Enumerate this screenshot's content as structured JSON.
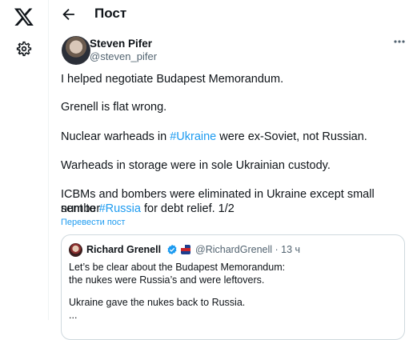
{
  "sidebar": {
    "logo_icon": "x-logo-icon",
    "settings_icon": "gear-icon"
  },
  "header": {
    "back_icon": "arrow-left-icon",
    "title": "Пост"
  },
  "tweet": {
    "author_name": "Steven Pifer",
    "author_handle": "@steven_pifer",
    "more_icon": "more-horizontal-icon",
    "lines": {
      "l1": "I helped negotiate Budapest Memorandum.",
      "l2": "Grenell is flat wrong.",
      "l3_pre": "Nuclear warheads in ",
      "l3_tag": "#Ukraine",
      "l3_post": " were ex-Soviet, not Russian.",
      "l4": "Warheads in storage were in sole Ukrainian custody.",
      "l5": "ICBMs and bombers were eliminated in Ukraine except small number",
      "l6_pre": "sent to ",
      "l6_tag": "#Russia",
      "l6_post": " for debt relief. 1/2"
    },
    "translate_label": "Перевести пост"
  },
  "quote": {
    "author_name": "Richard Grenell",
    "verified_icon": "verified-badge-icon",
    "flag_icon": "affiliate-flag-icon",
    "author_handle": "@RichardGrenell · 13 ч",
    "lines": {
      "q1": "Let’s be clear about the Budapest Memorandum:",
      "q2": "the nukes were Russia’s and were leftovers.",
      "q3": "Ukraine gave the nukes back to Russia.",
      "q4": "..."
    }
  },
  "colors": {
    "accent": "#1d9bf0",
    "text": "#0f1419",
    "secondary": "#536471",
    "border": "#cfd9de"
  }
}
